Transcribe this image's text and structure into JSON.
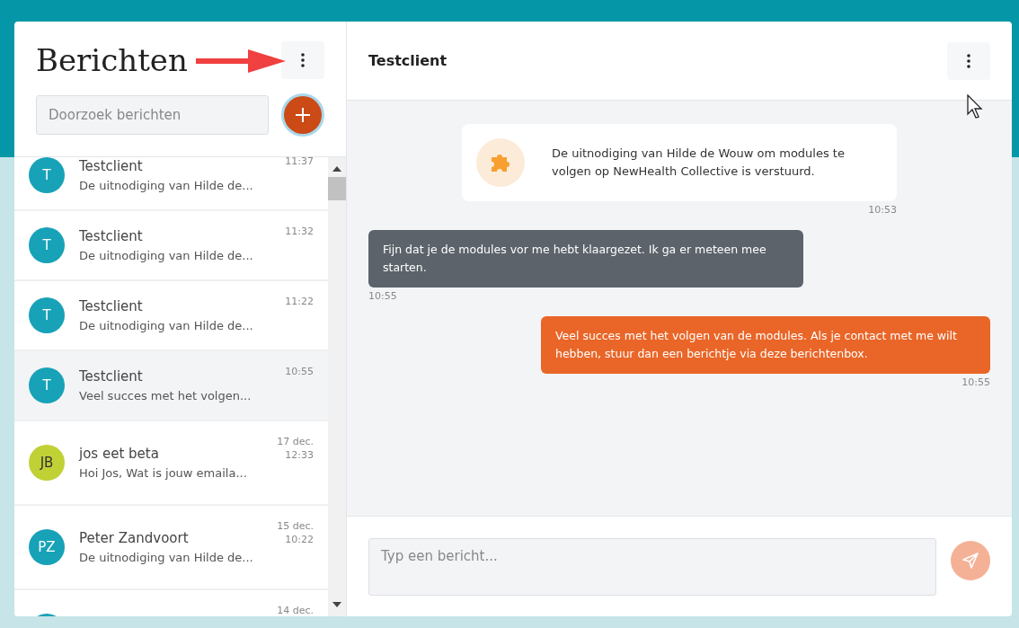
{
  "sidebar": {
    "title": "Berichten",
    "search": {
      "placeholder": "Doorzoek berichten"
    },
    "conversations": [
      {
        "initials": "T",
        "name": "Testclient",
        "time": "11:37",
        "preview": "De uitnodiging van Hilde de...",
        "color": "#17a2b8",
        "selected": false
      },
      {
        "initials": "T",
        "name": "Testclient",
        "time": "11:32",
        "preview": "De uitnodiging van Hilde de...",
        "color": "#17a2b8",
        "selected": false
      },
      {
        "initials": "T",
        "name": "Testclient",
        "time": "11:22",
        "preview": "De uitnodiging van Hilde de...",
        "color": "#17a2b8",
        "selected": false
      },
      {
        "initials": "T",
        "name": "Testclient",
        "time": "10:55",
        "preview": "Veel succes met het volgen...",
        "color": "#17a2b8",
        "selected": true
      },
      {
        "initials": "JB",
        "name": "jos eet beta",
        "date": "17 dec.",
        "time": "12:33",
        "preview": "Hoi Jos, Wat is jouw emaila...",
        "color": "#c0d136",
        "selected": false
      },
      {
        "initials": "PZ",
        "name": "Peter Zandvoort",
        "date": "15 dec.",
        "time": "10:22",
        "preview": "De uitnodiging van Hilde de...",
        "color": "#17a2b8",
        "selected": false
      },
      {
        "date": "14 dec.",
        "color": "#17a2b8",
        "selected": false
      }
    ]
  },
  "chat": {
    "title": "Testclient",
    "messages": [
      {
        "kind": "system",
        "text": "De uitnodiging van Hilde de Wouw om modules te volgen op NewHealth Collective is verstuurd.",
        "time": "10:53"
      },
      {
        "kind": "received",
        "text": "Fijn dat je de modules vor me hebt klaargezet. Ik ga er meteen mee starten.",
        "time": "10:55"
      },
      {
        "kind": "sent",
        "text": "Veel succes met het volgen van de modules. Als je contact met me wilt hebben, stuur dan een berichtje via deze berichtenbox.",
        "time": "10:55"
      }
    ],
    "composer": {
      "placeholder": "Typ een bericht..."
    }
  }
}
